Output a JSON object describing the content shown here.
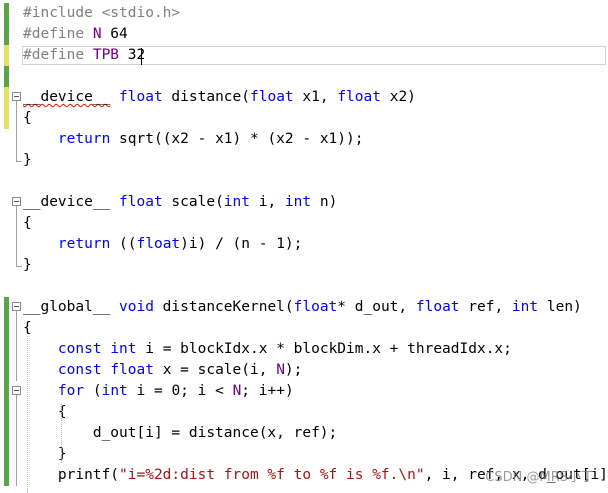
{
  "editor": {
    "colors": {
      "keyword": "#0000ff",
      "preprocessor": "#808080",
      "string": "#a31515",
      "macro": "#6f008a",
      "change_saved": "#57a64a",
      "change_unsaved": "#e8e05f",
      "error_squiggle": "#e51400"
    },
    "lines": [
      {
        "gutter": "green",
        "fold": null,
        "tokens": [
          [
            "pp",
            "#include <stdio.h>"
          ]
        ]
      },
      {
        "gutter": "green",
        "fold": null,
        "tokens": [
          [
            "pp",
            "#define "
          ],
          [
            "macro",
            "N"
          ],
          [
            "plain",
            " 64"
          ]
        ]
      },
      {
        "gutter": "yellow",
        "fold": null,
        "tokens": [
          [
            "pp",
            "#define "
          ],
          [
            "macro",
            "TPB"
          ],
          [
            "plain",
            " 32"
          ]
        ]
      },
      {
        "gutter": "green",
        "fold": null,
        "tokens": []
      },
      {
        "gutter": "yellow",
        "fold": "start",
        "tokens": [
          [
            "squiggle",
            "__device__"
          ],
          [
            "plain",
            " "
          ],
          [
            "kw",
            "float"
          ],
          [
            "plain",
            " distance("
          ],
          [
            "kw",
            "float"
          ],
          [
            "plain",
            " x1, "
          ],
          [
            "kw",
            "float"
          ],
          [
            "plain",
            " x2)"
          ]
        ]
      },
      {
        "gutter": "yellow",
        "fold": "mid",
        "tokens": [
          [
            "plain",
            "{"
          ]
        ]
      },
      {
        "gutter": "none",
        "fold": "mid",
        "tokens": [
          [
            "plain",
            "    "
          ],
          [
            "kw",
            "return"
          ],
          [
            "plain",
            " sqrt((x2 - x1) * (x2 - x1));"
          ]
        ]
      },
      {
        "gutter": "none",
        "fold": "end",
        "tokens": [
          [
            "plain",
            "}"
          ]
        ]
      },
      {
        "gutter": "none",
        "fold": null,
        "tokens": []
      },
      {
        "gutter": "none",
        "fold": "start",
        "tokens": [
          [
            "plain",
            "__device__ "
          ],
          [
            "kw",
            "float"
          ],
          [
            "plain",
            " scale("
          ],
          [
            "kw",
            "int"
          ],
          [
            "plain",
            " i, "
          ],
          [
            "kw",
            "int"
          ],
          [
            "plain",
            " n)"
          ]
        ]
      },
      {
        "gutter": "none",
        "fold": "mid",
        "tokens": [
          [
            "plain",
            "{"
          ]
        ]
      },
      {
        "gutter": "none",
        "fold": "mid",
        "tokens": [
          [
            "plain",
            "    "
          ],
          [
            "kw",
            "return"
          ],
          [
            "plain",
            " (("
          ],
          [
            "kw",
            "float"
          ],
          [
            "plain",
            ")i) / (n - 1);"
          ]
        ]
      },
      {
        "gutter": "none",
        "fold": "end",
        "tokens": [
          [
            "plain",
            "}"
          ]
        ]
      },
      {
        "gutter": "none",
        "fold": null,
        "tokens": []
      },
      {
        "gutter": "green",
        "fold": "start",
        "tokens": [
          [
            "plain",
            "__global__ "
          ],
          [
            "kw",
            "void"
          ],
          [
            "plain",
            " distanceKernel("
          ],
          [
            "kw",
            "float"
          ],
          [
            "plain",
            "* d_out, "
          ],
          [
            "kw",
            "float"
          ],
          [
            "plain",
            " ref, "
          ],
          [
            "kw",
            "int"
          ],
          [
            "plain",
            " len)"
          ]
        ]
      },
      {
        "gutter": "green",
        "fold": "mid",
        "tokens": [
          [
            "plain",
            "{"
          ]
        ]
      },
      {
        "gutter": "green",
        "fold": "mid",
        "tokens": [
          [
            "plain",
            "    "
          ],
          [
            "kw",
            "const"
          ],
          [
            "plain",
            " "
          ],
          [
            "kw",
            "int"
          ],
          [
            "plain",
            " i = blockIdx.x * blockDim.x + threadIdx.x;"
          ]
        ]
      },
      {
        "gutter": "green",
        "fold": "mid",
        "tokens": [
          [
            "plain",
            "    "
          ],
          [
            "kw",
            "const"
          ],
          [
            "plain",
            " "
          ],
          [
            "kw",
            "float"
          ],
          [
            "plain",
            " x = scale(i, "
          ],
          [
            "macro",
            "N"
          ],
          [
            "plain",
            ");"
          ]
        ]
      },
      {
        "gutter": "green",
        "fold": "start2",
        "tokens": [
          [
            "plain",
            "    "
          ],
          [
            "kw",
            "for"
          ],
          [
            "plain",
            " ("
          ],
          [
            "kw",
            "int"
          ],
          [
            "plain",
            " i = 0; i < "
          ],
          [
            "macro",
            "N"
          ],
          [
            "plain",
            "; i++)"
          ]
        ]
      },
      {
        "gutter": "green",
        "fold": "mid",
        "tokens": [
          [
            "plain",
            "    {"
          ]
        ]
      },
      {
        "gutter": "green",
        "fold": "mid",
        "tokens": [
          [
            "plain",
            "        d_out[i] = distance(x, ref);"
          ]
        ]
      },
      {
        "gutter": "green",
        "fold": "mid",
        "tokens": [
          [
            "plain",
            "    }"
          ]
        ]
      },
      {
        "gutter": "green",
        "fold": "mid",
        "tokens": [
          [
            "plain",
            "    printf("
          ],
          [
            "str",
            "\"i=%2d:dist from %f to %f is %f.\\n\""
          ],
          [
            "plain",
            ", i, ref, x, d_out[i]);"
          ]
        ]
      }
    ]
  },
  "watermark": "CSDN @MRS小丁"
}
